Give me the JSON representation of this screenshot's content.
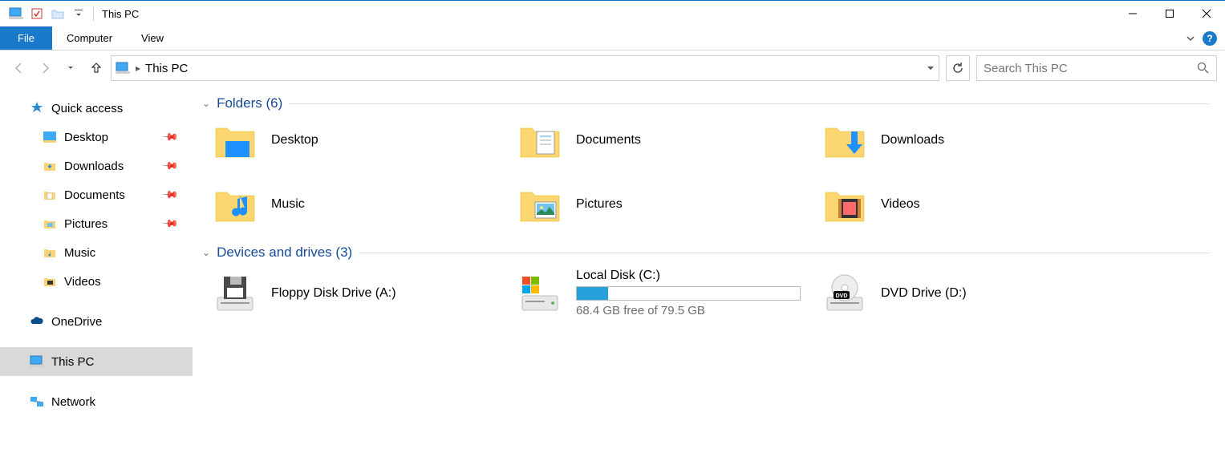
{
  "titlebar": {
    "title": "This PC"
  },
  "ribbon": {
    "file": "File",
    "tabs": [
      "Computer",
      "View"
    ]
  },
  "address": {
    "location": "This PC",
    "search_placeholder": "Search This PC"
  },
  "sidebar": {
    "quick_access": {
      "label": "Quick access",
      "items": [
        {
          "label": "Desktop",
          "pinned": true
        },
        {
          "label": "Downloads",
          "pinned": true
        },
        {
          "label": "Documents",
          "pinned": true
        },
        {
          "label": "Pictures",
          "pinned": true
        },
        {
          "label": "Music",
          "pinned": false
        },
        {
          "label": "Videos",
          "pinned": false
        }
      ]
    },
    "onedrive": {
      "label": "OneDrive"
    },
    "this_pc": {
      "label": "This PC"
    },
    "network": {
      "label": "Network"
    }
  },
  "sections": {
    "folders": {
      "title": "Folders (6)",
      "items": [
        {
          "label": "Desktop"
        },
        {
          "label": "Documents"
        },
        {
          "label": "Downloads"
        },
        {
          "label": "Music"
        },
        {
          "label": "Pictures"
        },
        {
          "label": "Videos"
        }
      ]
    },
    "drives": {
      "title": "Devices and drives (3)",
      "items": [
        {
          "label": "Floppy Disk Drive (A:)"
        },
        {
          "label": "Local Disk (C:)",
          "free_text": "68.4 GB free of 79.5 GB",
          "used_pct": 14
        },
        {
          "label": "DVD Drive (D:)"
        }
      ]
    }
  }
}
